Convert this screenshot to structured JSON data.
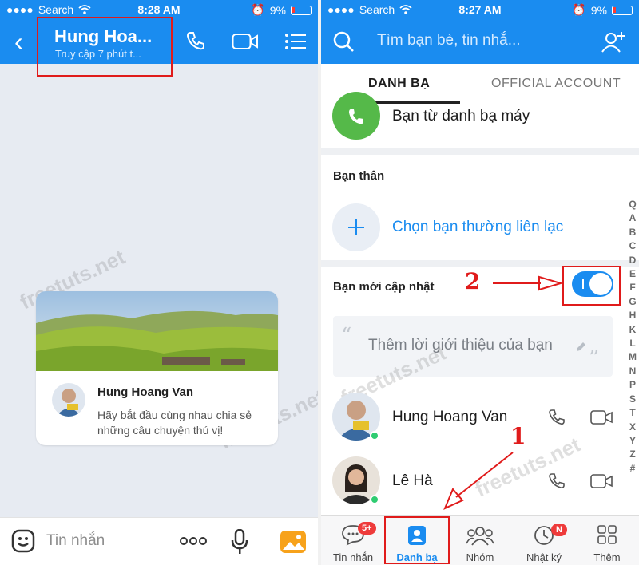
{
  "left": {
    "status": {
      "carrier": "Search",
      "time": "8:28 AM",
      "battery": "9%"
    },
    "header": {
      "title": "Hung Hoa...",
      "subtitle": "Truy cập 7 phút t..."
    },
    "card": {
      "name": "Hung Hoang Van",
      "message": "Hãy bắt đầu cùng nhau chia sẻ những câu chuyện thú vị!"
    },
    "composer": {
      "placeholder": "Tin nhắn"
    },
    "watermark": "freetuts.net"
  },
  "right": {
    "status": {
      "carrier": "Search",
      "time": "8:27 AM",
      "battery": "9%"
    },
    "search": {
      "placeholder": "Tìm bạn bè, tin nhắ..."
    },
    "tabs": [
      {
        "label": "DANH BẠ"
      },
      {
        "label": "OFFICIAL ACCOUNT"
      }
    ],
    "phonebook": {
      "label": "Bạn từ danh bạ máy"
    },
    "best_friends": {
      "title": "Bạn thân",
      "add_label": "Chọn bạn thường liên lạc"
    },
    "updates": {
      "title": "Bạn mới cập nhật",
      "toggle_on": true,
      "intro_placeholder": "Thêm lời giới thiệu của bạn"
    },
    "alphabet": [
      "Q",
      "A",
      "B",
      "C",
      "D",
      "E",
      "F",
      "G",
      "H",
      "K",
      "L",
      "M",
      "N",
      "P",
      "S",
      "T",
      "X",
      "Y",
      "Z",
      "#"
    ],
    "contacts": [
      {
        "name": "Hung Hoang Van",
        "online": true
      },
      {
        "name": "Lê Hà",
        "online": true
      }
    ],
    "nav": [
      {
        "label": "Tin nhắn",
        "badge": "5+",
        "icon": "chat-icon"
      },
      {
        "label": "Danh bạ",
        "badge": "",
        "icon": "contacts-icon",
        "active": true
      },
      {
        "label": "Nhóm",
        "badge": "",
        "icon": "group-icon"
      },
      {
        "label": "Nhật ký",
        "badge": "N",
        "icon": "clock-icon"
      },
      {
        "label": "Thêm",
        "badge": "",
        "icon": "grid-icon"
      }
    ],
    "annotations": {
      "step1": "1",
      "step2": "2"
    },
    "watermark": "freetuts.net"
  },
  "colors": {
    "brand": "#1a8cf0",
    "annotation": "#e01b1b",
    "badge": "#ee3b3b",
    "online": "#2ecc71"
  }
}
